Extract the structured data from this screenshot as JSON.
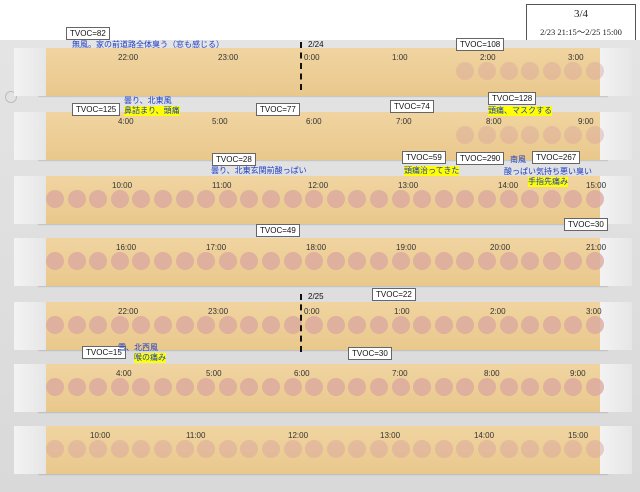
{
  "header": {
    "page": "3/4",
    "date_range": "2/23 21:15～2/25 15:00"
  },
  "day_markers": [
    {
      "label": "2/24"
    },
    {
      "label": "2/25"
    }
  ],
  "strips": [
    {
      "ticks": [
        "22:00",
        "23:00",
        "0:00",
        "1:00",
        "2:00",
        "3:00"
      ],
      "tvoc": [
        "TVOC=82",
        "TVOC=108"
      ],
      "notes": [
        "無風。家の前道路全体臭う（窓も感じる）"
      ],
      "highlights": []
    },
    {
      "ticks": [
        "4:00",
        "5:00",
        "6:00",
        "7:00",
        "8:00",
        "9:00"
      ],
      "tvoc": [
        "TVOC=125",
        "TVOC=77",
        "TVOC=74",
        "TVOC=128"
      ],
      "notes": [
        "曇り、北東風"
      ],
      "highlights": [
        "鼻詰まり、頭痛",
        "頭痛、マスクする"
      ]
    },
    {
      "ticks": [
        "10:00",
        "11:00",
        "12:00",
        "13:00",
        "14:00",
        "15:00"
      ],
      "tvoc": [
        "TVOC=28",
        "TVOC=59",
        "TVOC=290",
        "TVOC=267"
      ],
      "notes": [
        "曇り、北東玄関前酸っぱい",
        "南風",
        "酸っぱい気持ち悪い臭い"
      ],
      "highlights": [
        "頭痛治ってきた",
        "手指先痛み"
      ]
    },
    {
      "ticks": [
        "16:00",
        "17:00",
        "18:00",
        "19:00",
        "20:00",
        "21:00"
      ],
      "tvoc": [
        "TVOC=49",
        "TVOC=30"
      ],
      "notes": [],
      "highlights": []
    },
    {
      "ticks": [
        "22:00",
        "23:00",
        "0:00",
        "1:00",
        "2:00",
        "3:00"
      ],
      "tvoc": [
        "TVOC=22"
      ],
      "notes": [],
      "highlights": []
    },
    {
      "ticks": [
        "4:00",
        "5:00",
        "6:00",
        "7:00",
        "8:00",
        "9:00"
      ],
      "tvoc": [
        "TVOC=15",
        "TVOC=30"
      ],
      "notes": [
        "雪、北西風"
      ],
      "highlights": [
        "喉の痛み"
      ]
    },
    {
      "ticks": [
        "10:00",
        "11:00",
        "12:00",
        "13:00",
        "14:00",
        "15:00"
      ],
      "tvoc": [],
      "notes": [],
      "highlights": []
    }
  ],
  "colors": {
    "strip": "#ecca90",
    "dot": "#d9a6a0",
    "note_text": "#1a3cc8",
    "highlight": "#ffff00"
  }
}
